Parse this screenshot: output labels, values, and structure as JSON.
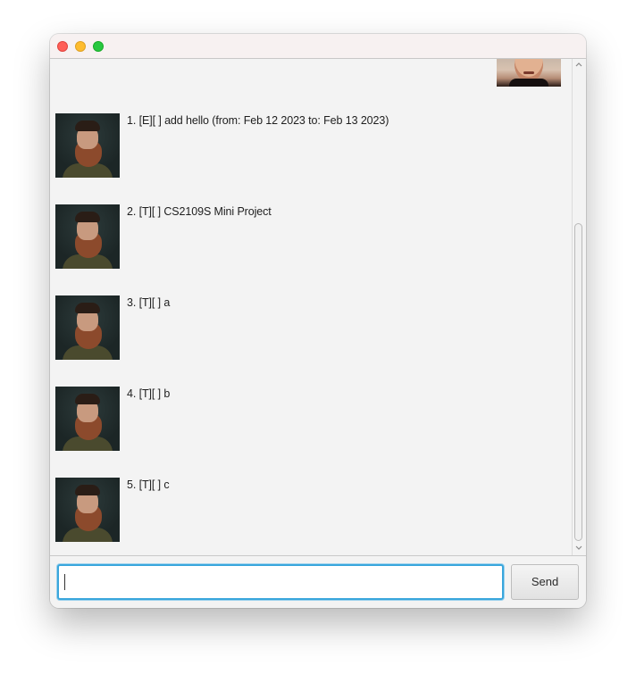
{
  "input": {
    "value": "",
    "placeholder": ""
  },
  "send_button": {
    "label": "Send"
  },
  "messages": [
    {
      "index": 1,
      "text": "1. [E][ ] add hello (from: Feb 12 2023 to: Feb 13 2023)"
    },
    {
      "index": 2,
      "text": "2. [T][ ] CS2109S Mini Project"
    },
    {
      "index": 3,
      "text": "3. [T][ ] a"
    },
    {
      "index": 4,
      "text": "4. [T][ ] b"
    },
    {
      "index": 5,
      "text": "5. [T][ ] c"
    }
  ],
  "icons": {
    "scroll_up": "chevron-up-icon",
    "scroll_down": "chevron-down-icon"
  },
  "colors": {
    "input_focus_border": "#39a6dc",
    "window_background": "#f3f3f3",
    "close_light": "#ff5f57",
    "minimize_light": "#febc2e",
    "maximize_light": "#28c840"
  }
}
